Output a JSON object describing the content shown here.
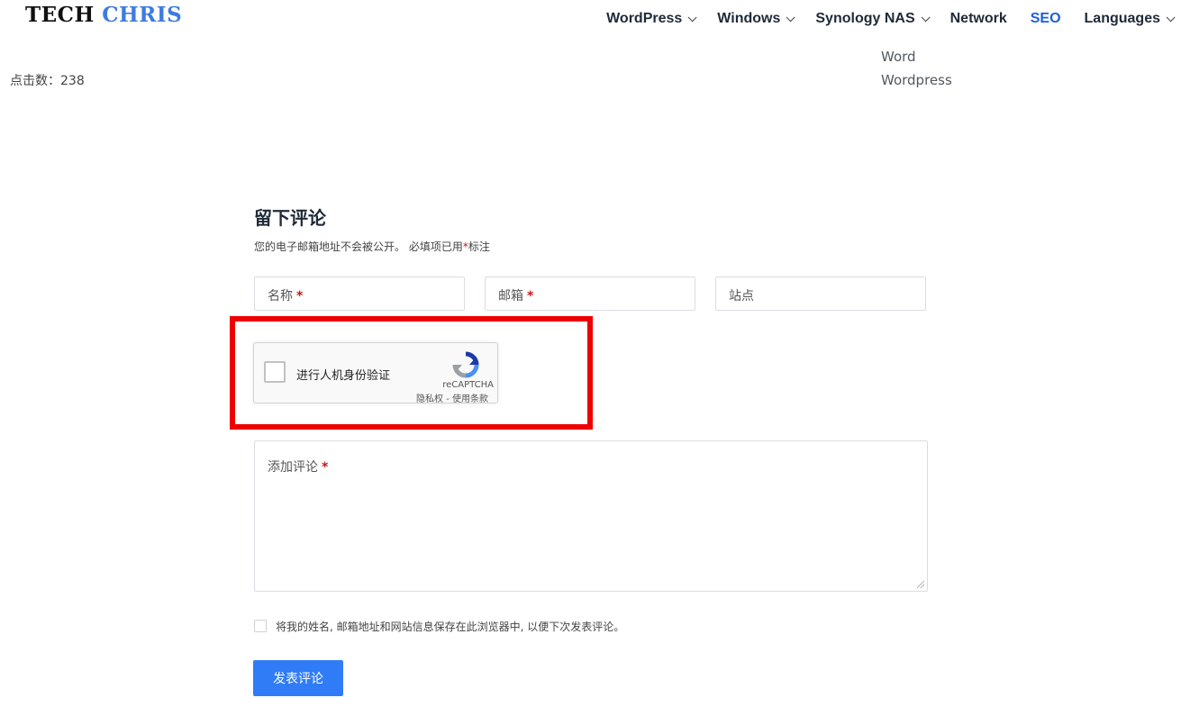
{
  "header": {
    "logo_part1": "TECH",
    "logo_part2": "CHRIS",
    "nav": [
      {
        "label": "WordPress",
        "has_dropdown": true
      },
      {
        "label": "Windows",
        "has_dropdown": true
      },
      {
        "label": "Synology NAS",
        "has_dropdown": true
      },
      {
        "label": "Network",
        "has_dropdown": false
      },
      {
        "label": "SEO",
        "has_dropdown": false,
        "active": true
      },
      {
        "label": "Languages",
        "has_dropdown": true
      }
    ]
  },
  "post_meta": {
    "clicks_label": "点击数：238"
  },
  "tags": [
    "Word",
    "Wordpress"
  ],
  "comment_form": {
    "title": "留下评论",
    "notes_prefix": "您的电子邮箱地址不会被公开。 必填项已用",
    "notes_star": "*",
    "notes_suffix": "标注",
    "name_placeholder": "名称",
    "email_placeholder": "邮箱",
    "site_placeholder": "站点",
    "required_mark": "*",
    "comment_placeholder": "添加评论",
    "consent_label": "将我的姓名, 邮箱地址和网站信息保存在此浏览器中, 以便下次发表评论。",
    "submit_label": "发表评论"
  },
  "recaptcha": {
    "checkbox_label": "进行人机身份验证",
    "brand": "reCAPTCHA",
    "links": "隐私权 - 使用条款"
  },
  "colors": {
    "accent": "#2f7cf6",
    "nav_active": "#1e5fd8",
    "highlight": "#ee0000",
    "required": "#c4161c"
  }
}
